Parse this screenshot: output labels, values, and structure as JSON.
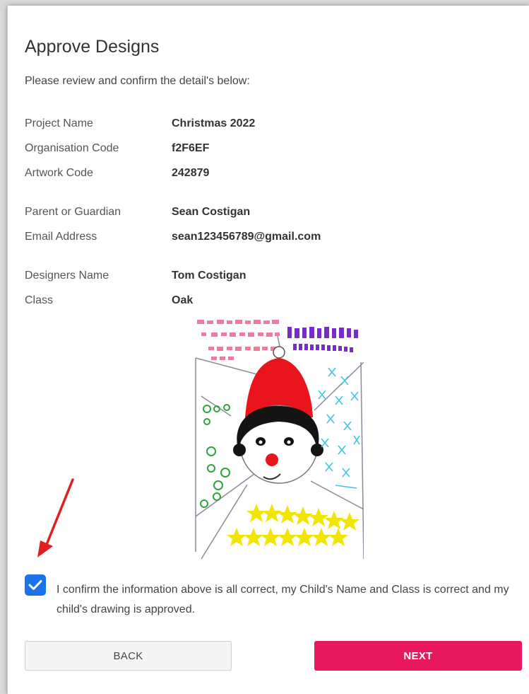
{
  "page": {
    "title": "Approve Designs",
    "subtitle": "Please review and confirm the detail's below:"
  },
  "details": {
    "project_name": {
      "label": "Project Name",
      "value": "Christmas 2022"
    },
    "organisation_code": {
      "label": "Organisation Code",
      "value": "f2F6EF"
    },
    "artwork_code": {
      "label": "Artwork Code",
      "value": "242879"
    },
    "parent": {
      "label": "Parent or Guardian",
      "value": "Sean Costigan"
    },
    "email": {
      "label": "Email Address",
      "value": "sean123456789@gmail.com"
    },
    "designer": {
      "label": "Designers Name",
      "value": "Tom Costigan"
    },
    "class": {
      "label": "Class",
      "value": "Oak"
    }
  },
  "confirmation": {
    "checked": true,
    "text": "I confirm the information above is all correct, my Child's Name and Class is correct and my child's drawing is approved."
  },
  "buttons": {
    "back": "BACK",
    "next": "NEXT"
  },
  "colors": {
    "accent": "#e8185f",
    "checkbox": "#1a73e8",
    "arrow": "#e02020"
  }
}
